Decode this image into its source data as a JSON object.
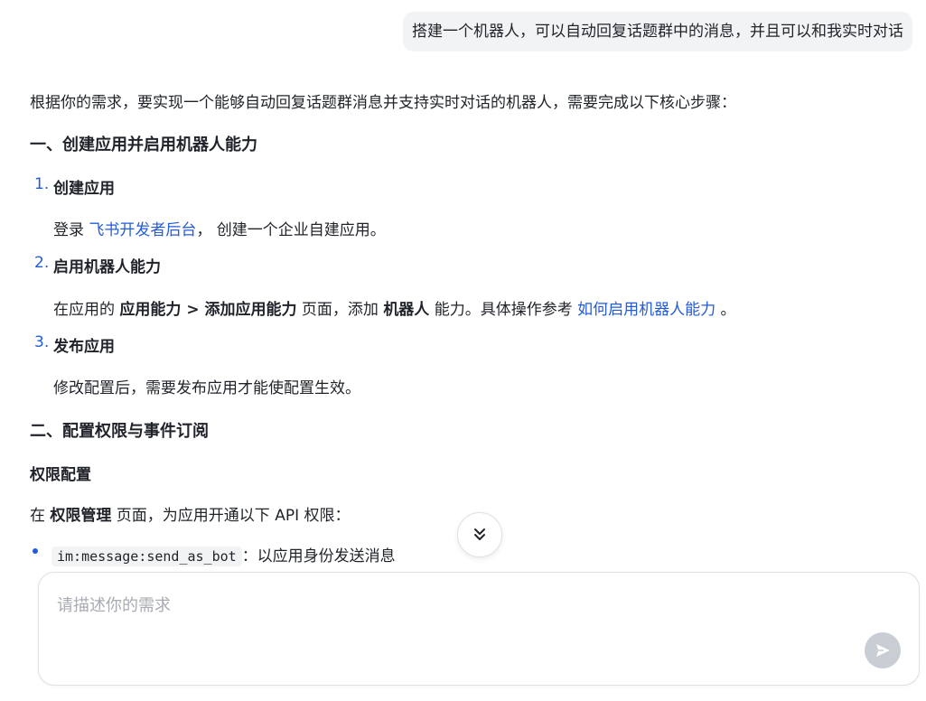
{
  "user_message": "搭建一个机器人，可以自动回复话题群中的消息，并且可以和我实时对话",
  "answer": {
    "intro": "根据你的需求，要实现一个能够自动回复话题群消息并支持实时对话的机器人，需要完成以下核心步骤：",
    "section1_title": "一、创建应用并启用机器人能力",
    "steps": [
      {
        "num": "1.",
        "title": "创建应用",
        "text_before": "登录 ",
        "link": "飞书开发者后台",
        "text_after": "， 创建一个企业自建应用。"
      },
      {
        "num": "2.",
        "title": "启用机器人能力",
        "p1": "在应用的 ",
        "b1": "应用能力 > 添加应用能力",
        "p2": " 页面，添加 ",
        "b2": "机器人",
        "p3": " 能力。具体操作参考 ",
        "link": "如何启用机器人能力",
        "p4": " 。"
      },
      {
        "num": "3.",
        "title": "发布应用",
        "text": "修改配置后，需要发布应用才能使配置生效。"
      }
    ],
    "section2_title": "二、配置权限与事件订阅",
    "permissions_heading": "权限配置",
    "permissions_intro_before": "在 ",
    "permissions_intro_bold": "权限管理",
    "permissions_intro_after": " 页面，为应用开通以下 API 权限：",
    "bullets": [
      {
        "code": "im:message:send_as_bot",
        "desc": "：以应用身份发送消息"
      }
    ]
  },
  "input": {
    "placeholder": "请描述你的需求"
  },
  "icons": {
    "scroll": "double-chevron-down-icon",
    "send": "send-icon"
  },
  "colors": {
    "link": "#245bdb",
    "send_disabled": "#c9cdd4"
  }
}
